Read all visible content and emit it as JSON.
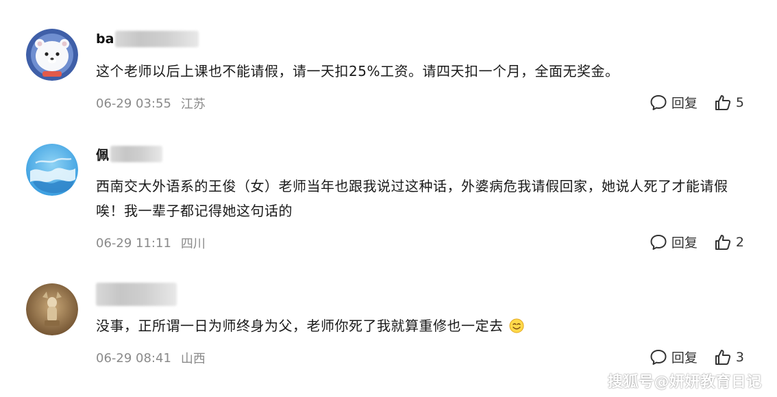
{
  "comments": [
    {
      "username": "ba",
      "text": "这个老师以后上课也不能请假，请一天扣25%工资。请四天扣一个月，全面无奖金。",
      "date": "06-29 03:55",
      "location": "江苏",
      "reply_label": "回复",
      "likes": "5",
      "avatar_icon": "polar-bear-astronaut-avatar"
    },
    {
      "username": "佩",
      "text": "西南交大外语系的王俊（女）老师当年也跟我说过这种话，外婆病危我请假回家，她说人死了才能请假唉！我一辈子都记得她这句话的",
      "date": "06-29 11:11",
      "location": "四川",
      "reply_label": "回复",
      "likes": "2",
      "avatar_icon": "blue-wave-avatar"
    },
    {
      "username": "",
      "text": "没事，正所谓一日为师终身为父，老师你死了我就算重修也一定去",
      "date": "06-29 08:41",
      "location": "山西",
      "reply_label": "回复",
      "likes": "3",
      "avatar_icon": "figurine-avatar",
      "trailing_emoji": "smiling-face-emoji"
    }
  ],
  "watermark": "搜狐号@妍妍教育日记",
  "colors": {
    "meta_gray": "#8a8a8a",
    "text": "#1a1a1a",
    "background": "#ffffff"
  }
}
